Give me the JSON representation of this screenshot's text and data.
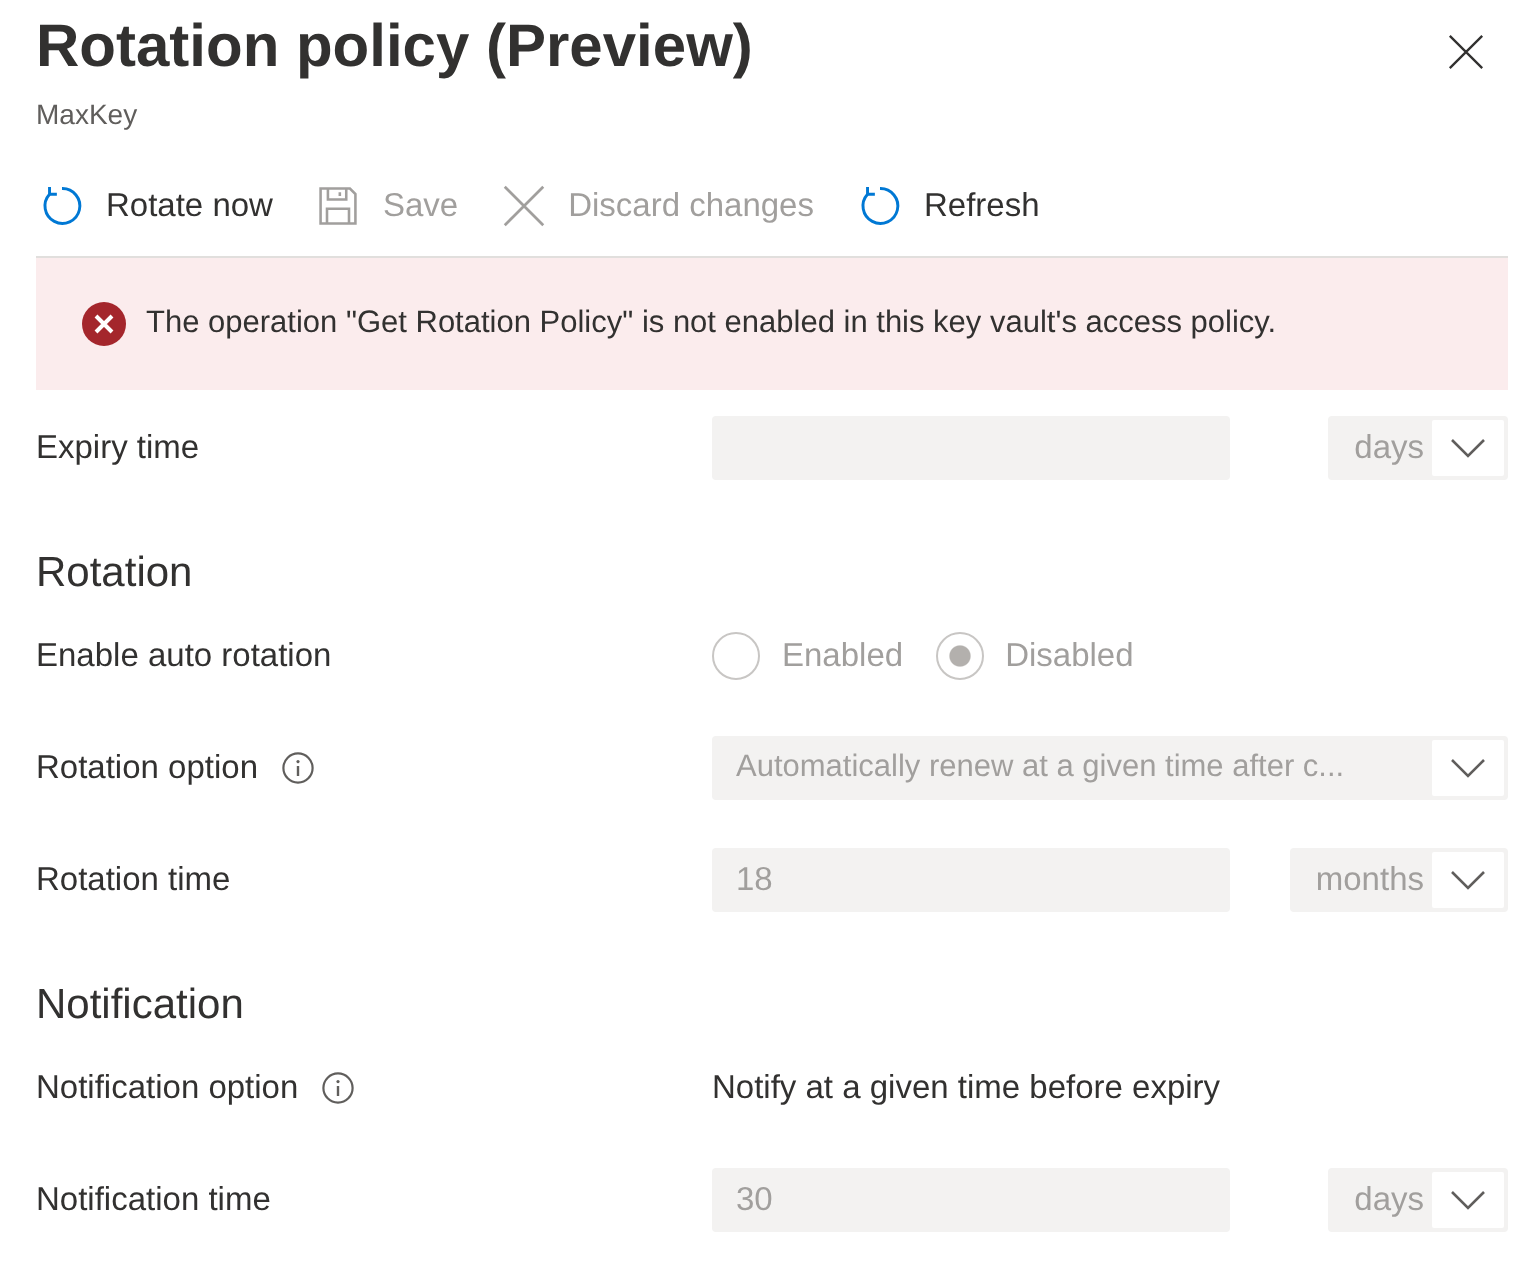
{
  "panel": {
    "title": "Rotation policy (Preview)",
    "subtitle": "MaxKey"
  },
  "toolbar": [
    {
      "kind": "rotate",
      "label": "Rotate now",
      "disabled": false
    },
    {
      "kind": "save",
      "label": "Save",
      "disabled": true
    },
    {
      "kind": "discard",
      "label": "Discard changes",
      "disabled": true
    },
    {
      "kind": "refresh",
      "label": "Refresh",
      "disabled": false
    }
  ],
  "message": {
    "kind": "error",
    "text": "The operation \"Get Rotation Policy\" is not enabled in this key vault's access policy."
  },
  "sections": [
    {
      "rows": [
        {
          "kind": "number_unit",
          "label": "Expiry time",
          "info": false,
          "disabled": true,
          "unit": "days"
        }
      ]
    },
    {
      "heading": "Rotation",
      "rows": [
        {
          "kind": "radio",
          "label": "Enable auto rotation",
          "info": false,
          "disabled": true,
          "options": [
            {
              "label": "Enabled",
              "selected": false
            },
            {
              "label": "Disabled",
              "selected": true
            }
          ]
        },
        {
          "kind": "dropdown",
          "label": "Rotation option",
          "info": true,
          "disabled": true,
          "value": "Automatically renew at a given time after c..."
        },
        {
          "kind": "number_unit",
          "label": "Rotation time",
          "info": false,
          "disabled": true,
          "value": "18",
          "unit": "months"
        }
      ]
    },
    {
      "heading": "Notification",
      "rows": [
        {
          "kind": "text",
          "label": "Notification option",
          "info": true,
          "value": "Notify at a given time before expiry"
        },
        {
          "kind": "number_unit",
          "label": "Notification time",
          "info": false,
          "disabled": true,
          "value": "30",
          "unit": "days"
        }
      ]
    }
  ]
}
